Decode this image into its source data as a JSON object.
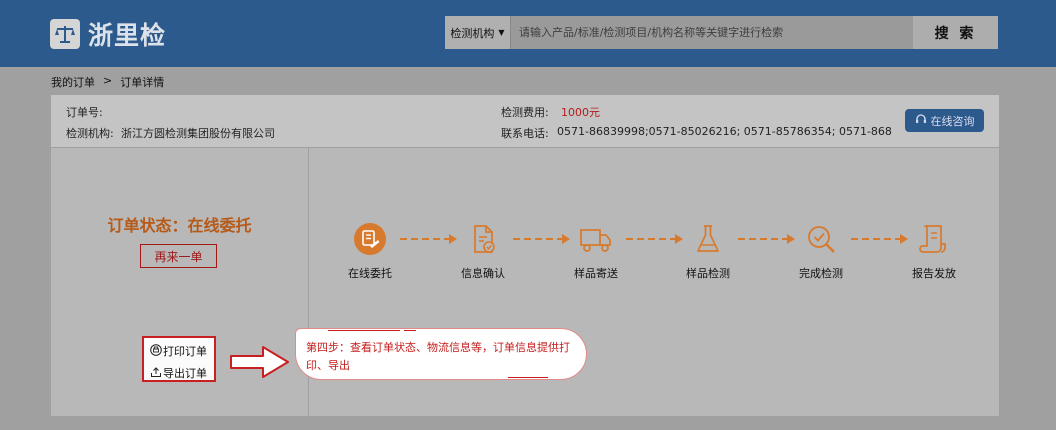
{
  "header": {
    "logo_text": "浙里检",
    "search_category": "检测机构",
    "search_placeholder": "请输入产品/标准/检测项目/机构名称等关键字进行检索",
    "search_button": "搜 索"
  },
  "breadcrumb": {
    "home": "我的订单",
    "separator": ">",
    "current": "订单详情"
  },
  "order_info": {
    "order_no_label": "订单号:",
    "order_no_value": "",
    "agency_label": "检测机构:",
    "agency_value": "浙江方圆检测集团股份有限公司",
    "fee_label": "检测费用:",
    "fee_value": "1000元",
    "phone_label": "联系电话:",
    "phone_value": "0571-86839998;0571-85026216; 0571-85786354; 0571-868",
    "consult_label": "在线咨询"
  },
  "left_panel": {
    "status_text": "订单状态：在线委托",
    "reorder_label": "再来一单",
    "print_label": "打印订单",
    "export_label": "导出订单"
  },
  "steps": [
    {
      "label": "在线委托",
      "icon": "entrust-icon",
      "active": true
    },
    {
      "label": "信息确认",
      "icon": "document-check-icon",
      "active": false
    },
    {
      "label": "样品寄送",
      "icon": "truck-icon",
      "active": false
    },
    {
      "label": "样品检测",
      "icon": "flask-icon",
      "active": false
    },
    {
      "label": "完成检测",
      "icon": "magnifier-check-icon",
      "active": false
    },
    {
      "label": "报告发放",
      "icon": "scroll-report-icon",
      "active": false
    }
  ],
  "callout": {
    "text": "第四步：查看订单状态、物流信息等，订单信息提供打印、导出"
  },
  "colors": {
    "header_bg": "#2d5a8c",
    "accent_orange": "#d77a2e",
    "fee_red": "#b31b1b",
    "annotation_red": "#c82020"
  }
}
